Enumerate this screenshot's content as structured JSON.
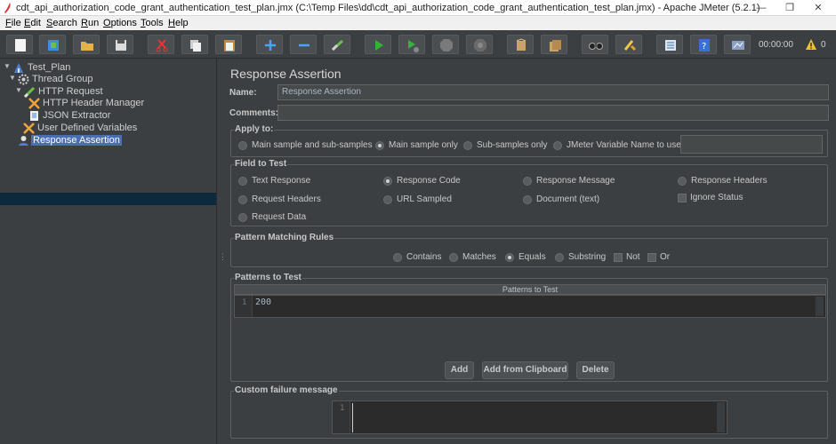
{
  "window": {
    "title": "cdt_api_authorization_code_grant_authentication_test_plan.jmx (C:\\Temp Files\\dd\\cdt_api_authorization_code_grant_authentication_test_plan.jmx) - Apache JMeter (5.2.1)",
    "controls": [
      "minimize",
      "restore",
      "close"
    ]
  },
  "menu": {
    "items": [
      {
        "first": "F",
        "rest": "ile"
      },
      {
        "first": "E",
        "rest": "dit"
      },
      {
        "first": "S",
        "rest": "earch"
      },
      {
        "first": "R",
        "rest": "un"
      },
      {
        "first": "O",
        "rest": "ptions"
      },
      {
        "first": "T",
        "rest": "ools"
      },
      {
        "first": "H",
        "rest": "elp"
      }
    ]
  },
  "toolbar": {
    "icons": [
      "new-icon",
      "templates-icon",
      "open-icon",
      "save-icon",
      "cut-icon",
      "copy-icon",
      "paste-icon",
      "expand-icon",
      "collapse-icon",
      "toggle-icon",
      "start-icon",
      "start-no-pauses-icon",
      "stop-icon",
      "shutdown-icon",
      "clear-icon",
      "clear-all-icon",
      "search-icon",
      "reset-search-icon",
      "function-helper-icon",
      "help-icon",
      "remote-icon"
    ],
    "elapsed": "00:00:00",
    "warning_count": "0"
  },
  "tree": {
    "nodes": [
      {
        "label": "Test_Plan",
        "icon": "test-plan-icon"
      },
      {
        "label": "Thread Group",
        "icon": "thread-group-icon"
      },
      {
        "label": "HTTP Request",
        "icon": "http-request-icon"
      },
      {
        "label": "HTTP Header Manager",
        "icon": "header-manager-icon"
      },
      {
        "label": "JSON Extractor",
        "icon": "json-extractor-icon"
      },
      {
        "label": "User Defined Variables",
        "icon": "variables-icon"
      },
      {
        "label": "Response Assertion",
        "icon": "assertion-icon"
      }
    ],
    "selected": "Response Assertion"
  },
  "panel": {
    "title": "Response Assertion",
    "name_label": "Name:",
    "name_value": "Response Assertion",
    "comments_label": "Comments:",
    "comments_value": "",
    "apply_to": {
      "title": "Apply to:",
      "options": [
        "Main sample and sub-samples",
        "Main sample only",
        "Sub-samples only",
        "JMeter Variable Name to use"
      ],
      "selected": "Main sample only",
      "variable_value": ""
    },
    "field_to_test": {
      "title": "Field to Test",
      "options": [
        "Text Response",
        "Response Code",
        "Response Message",
        "Response Headers",
        "Request Headers",
        "URL Sampled",
        "Document (text)",
        "Request Data"
      ],
      "selected": "Response Code",
      "ignore_status": "Ignore Status"
    },
    "pattern_matching": {
      "title": "Pattern Matching Rules",
      "options": [
        "Contains",
        "Matches",
        "Equals",
        "Substring"
      ],
      "selected": "Equals",
      "not_label": "Not",
      "or_label": "Or"
    },
    "patterns": {
      "title": "Patterns to Test",
      "column": "Patterns to Test",
      "line_number": "1",
      "value": "200",
      "buttons": [
        "Add",
        "Add from Clipboard",
        "Delete"
      ]
    },
    "failure": {
      "title": "Custom failure message",
      "line_number": "1",
      "value": ""
    }
  }
}
